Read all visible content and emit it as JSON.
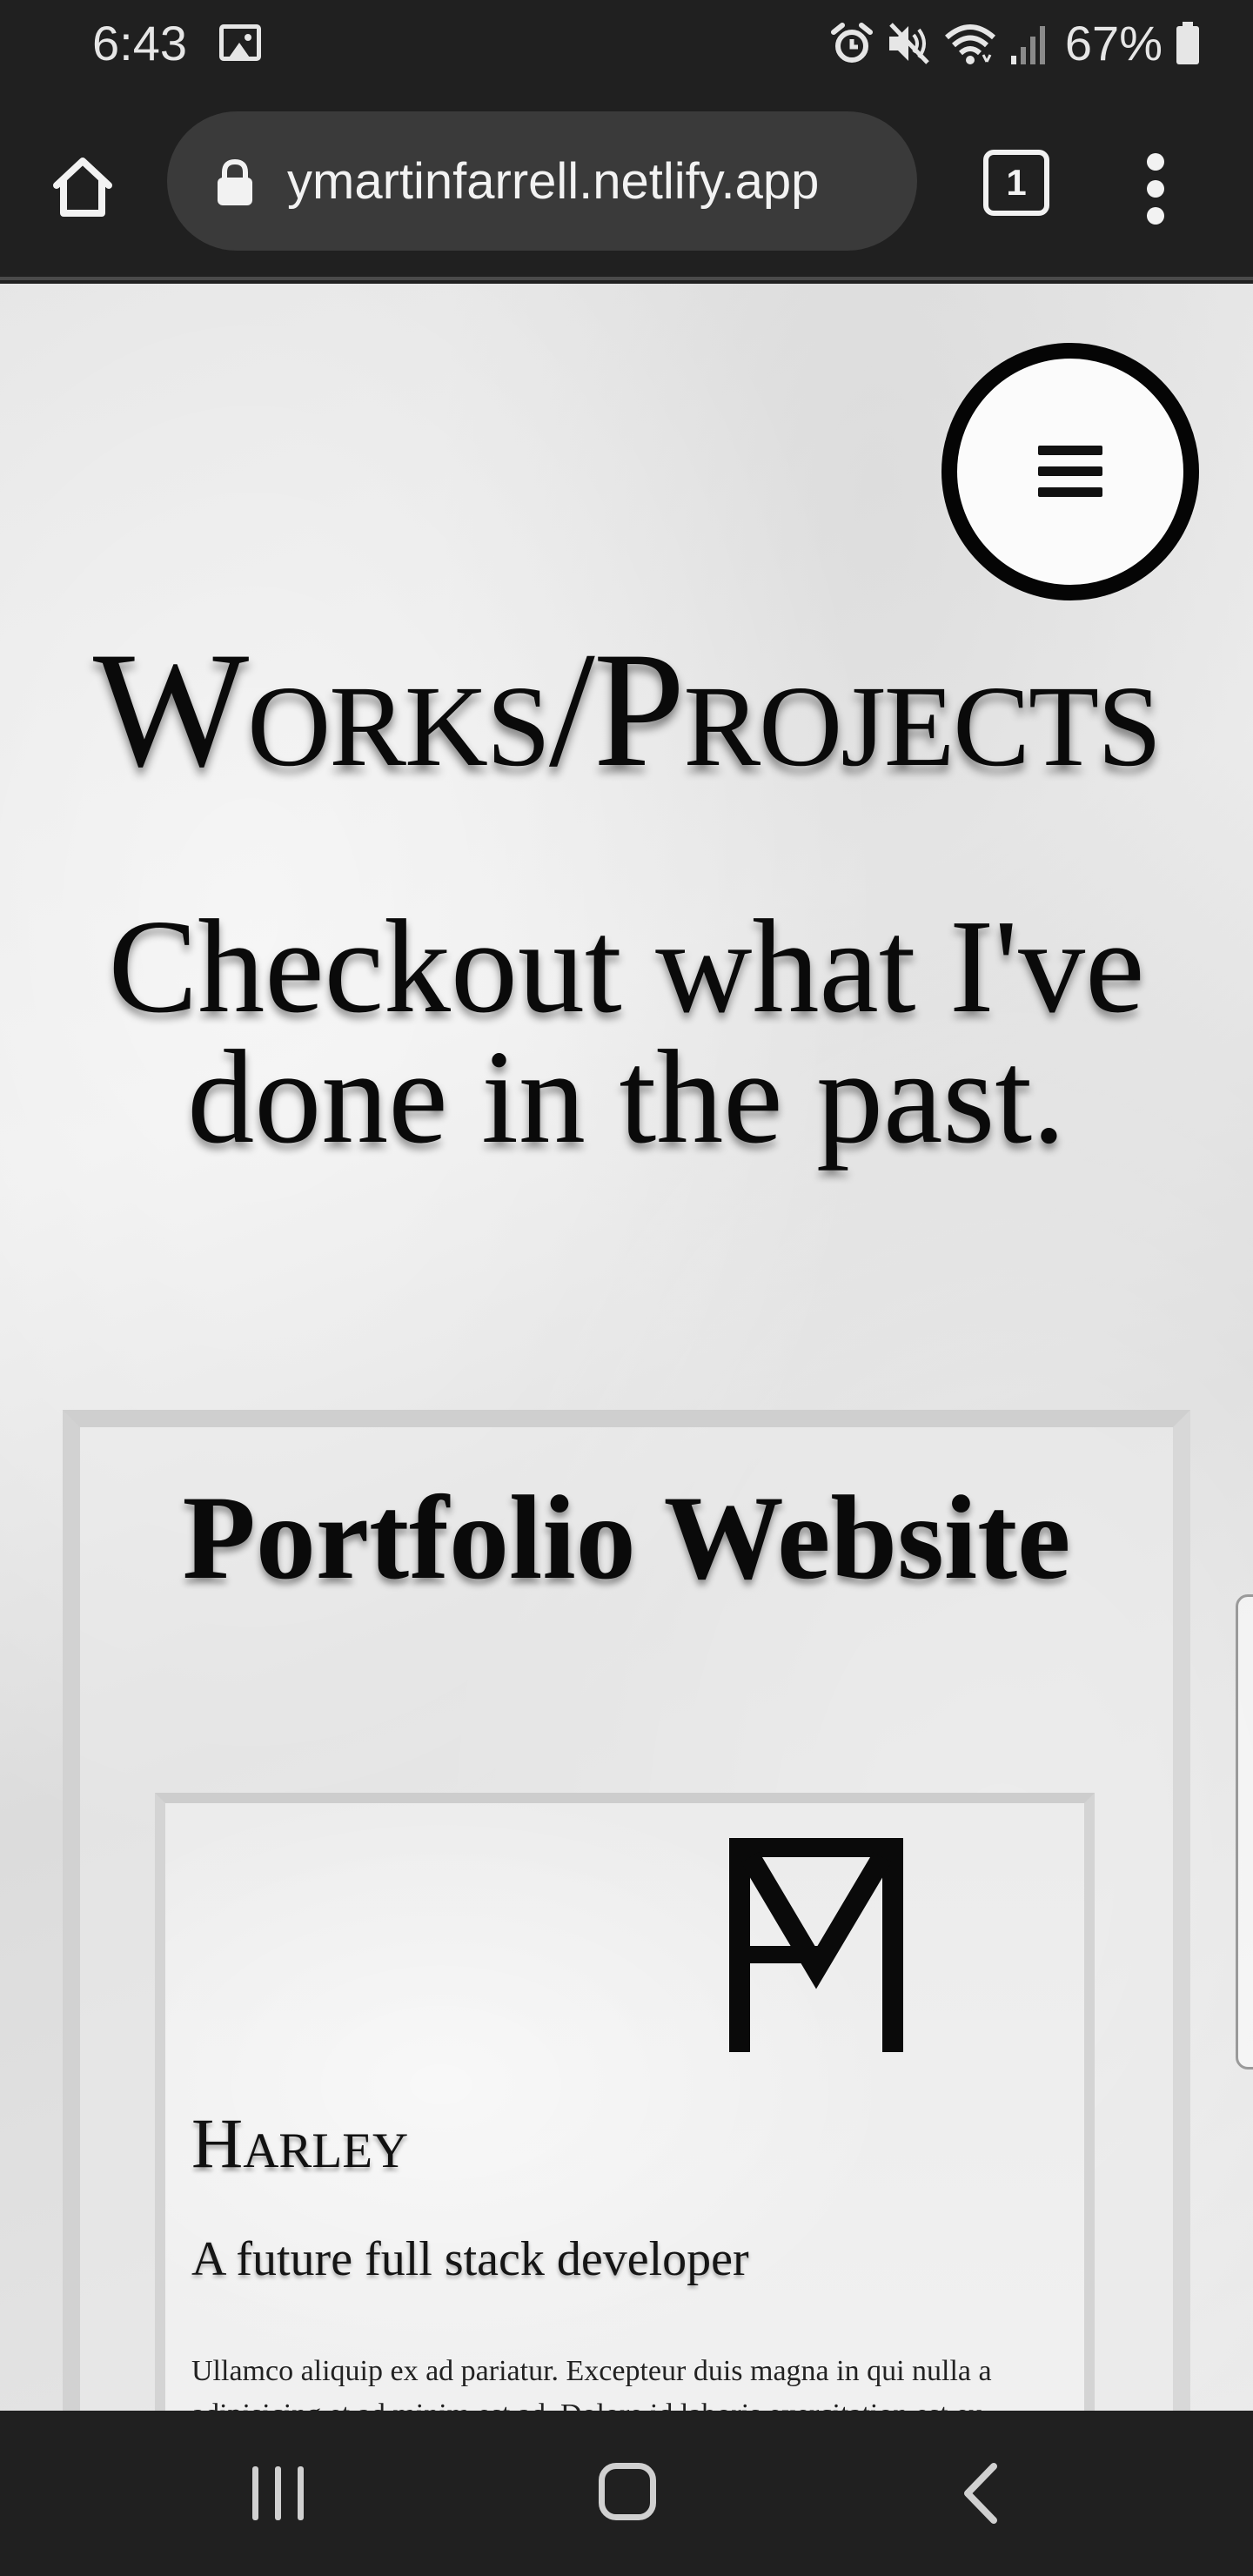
{
  "status_bar": {
    "time": "6:43",
    "battery_percent": "67%",
    "icons": [
      "gallery-icon",
      "alarm-icon",
      "mute-icon",
      "wifi-icon",
      "signal-icon",
      "battery-icon"
    ]
  },
  "browser": {
    "url": "ymartinfarrell.netlify.app",
    "tab_count": "1",
    "icons": [
      "home-icon",
      "lock-icon",
      "more-vert-icon"
    ]
  },
  "page": {
    "title": "Works/Projects",
    "subtitle": "Checkout what I've done in the past.",
    "menu_icon": "hamburger-icon",
    "project": {
      "title": "Portfolio Website",
      "preview": {
        "logo_icon": "mf-monogram-logo",
        "name": "Harley",
        "tagline": "A future full stack developer",
        "body_lines": [
          "Ullamco aliquip ex ad pariatur. Excepteur duis magna in qui nulla a",
          "adipisicing et ad minim est ad. Dolore id laboris exercitation est eu"
        ]
      }
    }
  },
  "nav_bar": {
    "icons": [
      "recents-icon",
      "home-icon",
      "back-icon"
    ]
  },
  "colors": {
    "system_bar": "#202020",
    "url_field": "#3a3a3a",
    "page_paper": "#e6e6e6",
    "ink": "#0a0a0a"
  }
}
